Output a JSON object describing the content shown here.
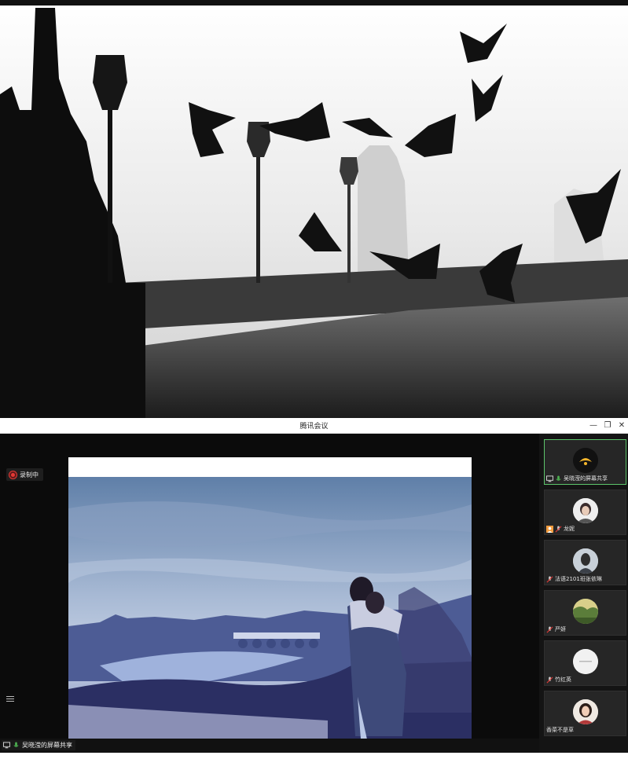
{
  "window": {
    "title": "腾讯会议",
    "controls": {
      "minimize": "—",
      "restore": "❐",
      "close": "✕"
    }
  },
  "recording": {
    "label": "录制中"
  },
  "screen_share": {
    "label": "吴晓滢的屏幕共享"
  },
  "participants": [
    {
      "name": "吴晓滢的屏幕共享",
      "avatar": "logo-avatar",
      "sharing": true,
      "mic": "on"
    },
    {
      "name": "龙妮",
      "avatar": "portrait-avatar",
      "sharing": false,
      "mic": "off"
    },
    {
      "name": "法语2101班张依琳",
      "avatar": "portrait-avatar",
      "sharing": false,
      "mic": "off"
    },
    {
      "name": "严妍",
      "avatar": "landscape-avatar",
      "sharing": false,
      "mic": "off"
    },
    {
      "name": "竹红英",
      "avatar": "text-avatar",
      "sharing": false,
      "mic": "off"
    },
    {
      "name": "香菜不是草",
      "avatar": "portrait-avatar",
      "sharing": false,
      "mic": "none"
    }
  ],
  "colors": {
    "active_border": "#5cc46a",
    "record_red": "#e53935",
    "mic_green": "#4caf50"
  }
}
